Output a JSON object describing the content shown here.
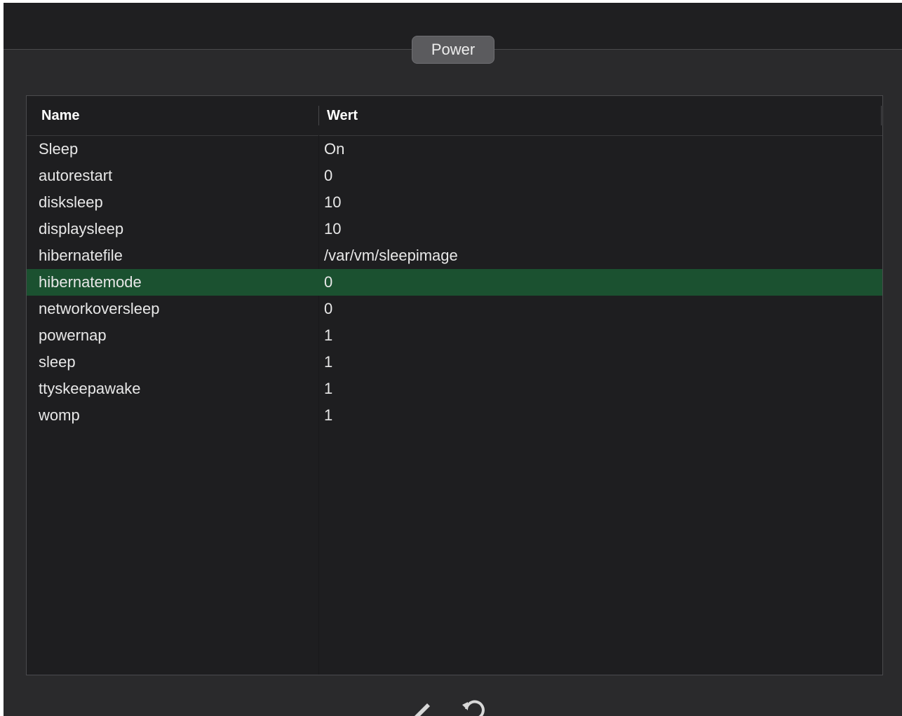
{
  "section": {
    "tab_label": "Power"
  },
  "table": {
    "columns": [
      "Name",
      "Wert"
    ],
    "rows": [
      {
        "name": "Sleep",
        "value": "On"
      },
      {
        "name": "autorestart",
        "value": "0"
      },
      {
        "name": "disksleep",
        "value": "10"
      },
      {
        "name": "displaysleep",
        "value": "10"
      },
      {
        "name": "hibernatefile",
        "value": "/var/vm/sleepimage"
      },
      {
        "name": "hibernatemode",
        "value": "0"
      },
      {
        "name": "networkoversleep",
        "value": "0"
      },
      {
        "name": "powernap",
        "value": "1"
      },
      {
        "name": "sleep",
        "value": "1"
      },
      {
        "name": "ttyskeepawake",
        "value": "1"
      },
      {
        "name": "womp",
        "value": "1"
      }
    ],
    "selected_row": "hibernatemode"
  },
  "toolbar": {
    "icons": [
      "pencil-icon",
      "revert-icon"
    ]
  },
  "colors": {
    "selection": "#1b5130",
    "window_bg": "#2a2a2c",
    "table_bg": "#1e1e20"
  }
}
